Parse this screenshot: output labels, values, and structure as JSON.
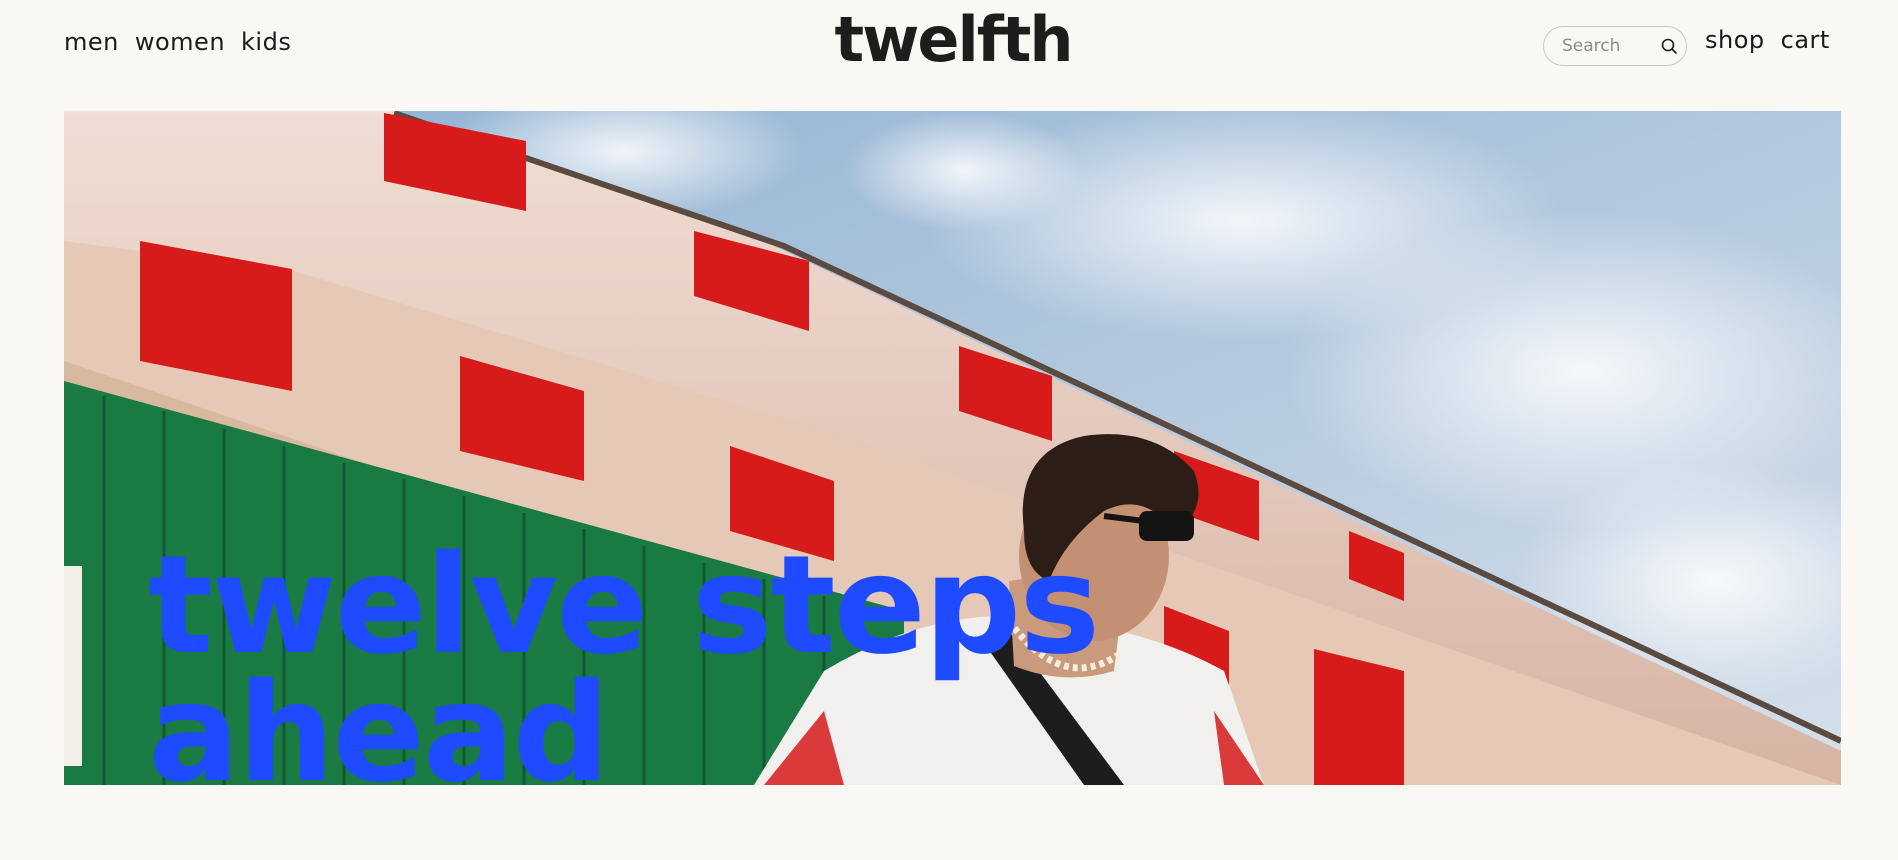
{
  "nav_left": {
    "items": [
      "men",
      "women",
      "kids"
    ]
  },
  "brand": {
    "logo_text": "twelfth"
  },
  "search": {
    "placeholder": "Search",
    "value": "",
    "icon": "search-icon"
  },
  "nav_right": {
    "shop_label": "shop",
    "cart_label": "cart"
  },
  "hero": {
    "headline_line1": "twelve steps",
    "headline_line2": "ahead",
    "headline_color": "#1e4bff",
    "image_subject": "man in white football shirt wearing sunglasses under a red-and-white striped stand roof against blue sky"
  },
  "colors": {
    "background": "#f9f8f5",
    "text": "#1b1b1b",
    "accent": "#1e4bff"
  }
}
